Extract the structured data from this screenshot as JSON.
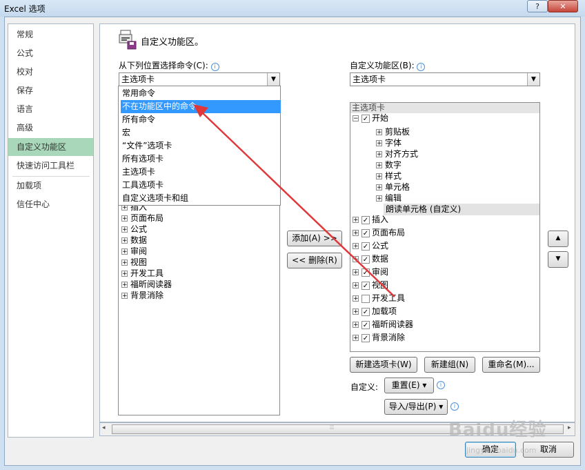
{
  "window": {
    "title": "Excel 选项",
    "help_btn": "?",
    "close_btn": "✕"
  },
  "nav": {
    "items": [
      "常规",
      "公式",
      "校对",
      "保存",
      "语言",
      "高级",
      "自定义功能区",
      "快速访问工具栏",
      "加载项",
      "信任中心"
    ],
    "selected": "自定义功能区"
  },
  "section": {
    "title": "自定义功能区。"
  },
  "left": {
    "label": "从下列位置选择命令(C):",
    "combo_value": "主选项卡",
    "dropdown_options": [
      "常用命令",
      "不在功能区中的命令",
      "所有命令",
      "宏",
      "“文件”选项卡",
      "所有选项卡",
      "主选项卡",
      "工具选项卡",
      "自定义选项卡和组"
    ],
    "highlighted": "不在功能区中的命令",
    "tree": [
      "插入",
      "页面布局",
      "公式",
      "数据",
      "审阅",
      "视图",
      "开发工具",
      "福昕阅读器",
      "背景消除"
    ]
  },
  "middle": {
    "add": "添加(A) >>",
    "remove": "<< 删除(R)"
  },
  "right": {
    "label": "自定义功能区(B):",
    "combo_value": "主选项卡",
    "header": "主选项卡",
    "start": "开始",
    "start_children": [
      "剪贴板",
      "字体",
      "对齐方式",
      "数字",
      "样式",
      "单元格",
      "编辑"
    ],
    "custom_group": "朗读单元格 (自定义)",
    "tabs": [
      {
        "label": "插入",
        "checked": true
      },
      {
        "label": "页面布局",
        "checked": true
      },
      {
        "label": "公式",
        "checked": true
      },
      {
        "label": "数据",
        "checked": true
      },
      {
        "label": "审阅",
        "checked": true
      },
      {
        "label": "视图",
        "checked": true
      },
      {
        "label": "开发工具",
        "checked": false
      },
      {
        "label": "加载项",
        "checked": true
      },
      {
        "label": "福昕阅读器",
        "checked": true
      },
      {
        "label": "背景消除",
        "checked": true
      }
    ],
    "new_tab": "新建选项卡(W)",
    "new_group": "新建组(N)",
    "rename": "重命名(M)...",
    "custom_label": "自定义:",
    "reset": "重置(E) ▾",
    "import_export": "导入/导出(P) ▾"
  },
  "footer": {
    "ok": "确定",
    "cancel": "取消"
  },
  "watermark": {
    "brand": "Baidu经验",
    "url": "jingyan.baidu.com"
  },
  "colors": {
    "accent_selected": "#a8d8b9",
    "highlight": "#3399ff",
    "arrow": "#e0383a"
  }
}
